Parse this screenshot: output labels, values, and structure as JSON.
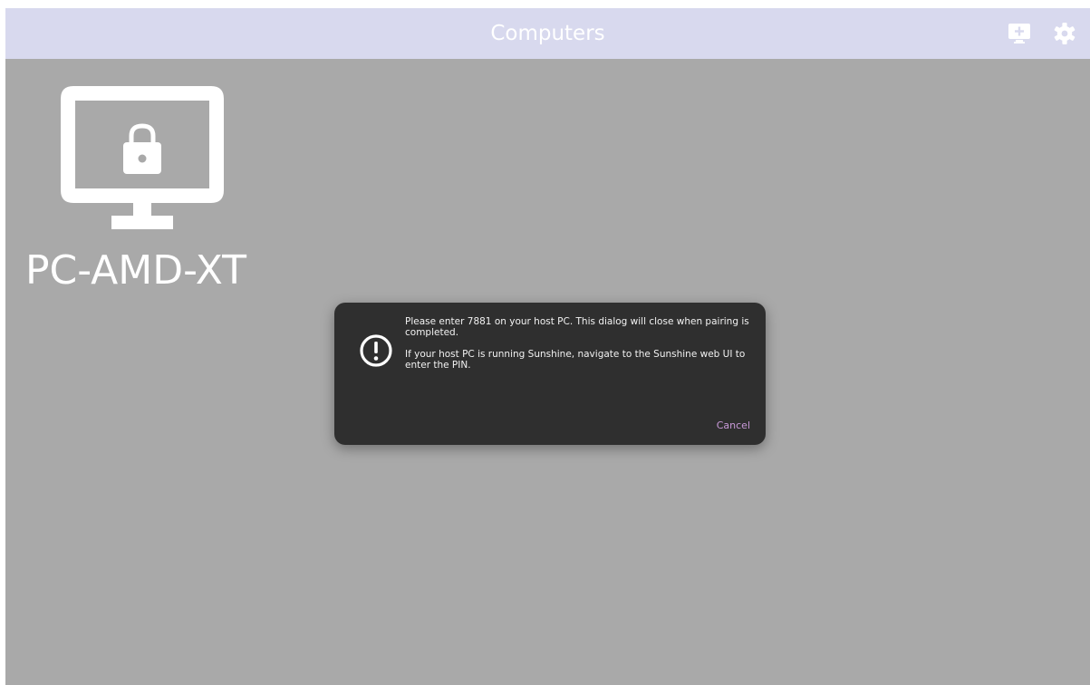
{
  "header": {
    "title": "Computers",
    "add_icon": "add-computer-icon",
    "settings_icon": "gear-icon"
  },
  "computers": [
    {
      "name": "PC-AMD-XT",
      "icon": "locked-monitor-icon",
      "state": "locked"
    }
  ],
  "dialog": {
    "icon": "exclamation-circle-icon",
    "message_line1": "Please enter 7881 on your host PC. This dialog will close when pairing is completed.",
    "message_line2": "If your host PC is running Sunshine, navigate to the Sunshine web UI to enter the PIN.",
    "cancel_label": "Cancel"
  },
  "colors": {
    "header_bg": "#d8d9ee",
    "body_bg": "#a9a9a9",
    "dialog_bg": "#2f2f2f",
    "accent": "#c99ad9"
  }
}
